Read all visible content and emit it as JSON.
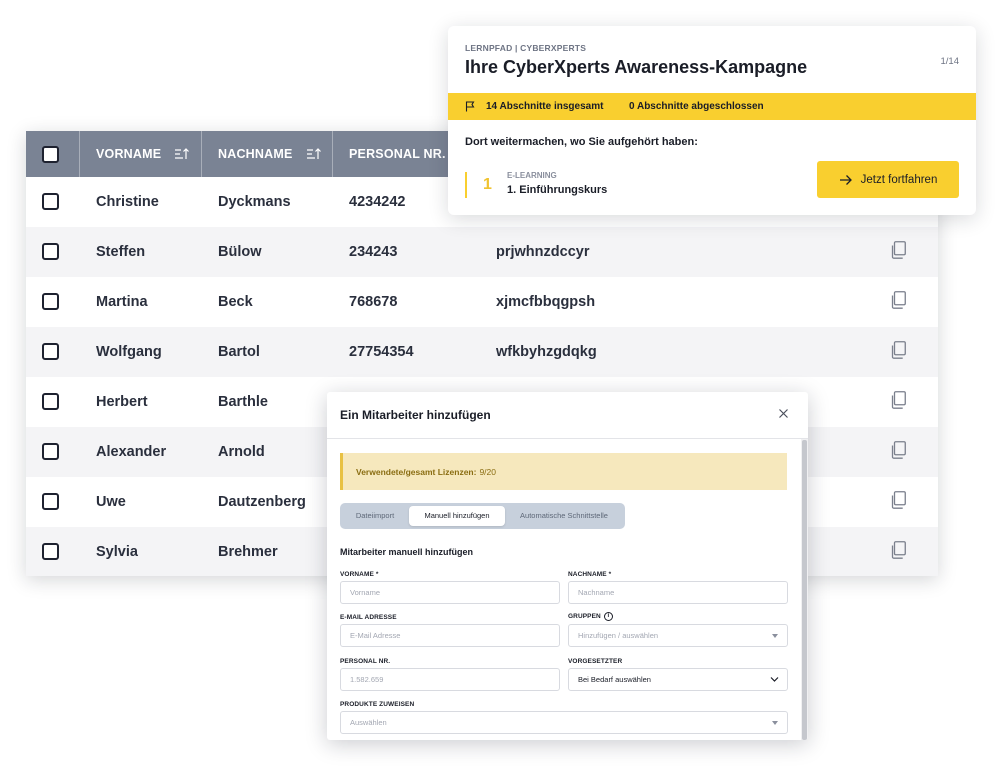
{
  "table": {
    "headers": {
      "vorname": "VORNAME",
      "nachname": "NACHNAME",
      "personal_nr": "PERSONAL NR."
    },
    "rows": [
      {
        "vorname": "Christine",
        "nachname": "Dyckmans",
        "personal_nr": "4234242",
        "code": ""
      },
      {
        "vorname": "Steffen",
        "nachname": "Bülow",
        "personal_nr": "234243",
        "code": "prjwhnzdccyr"
      },
      {
        "vorname": "Martina",
        "nachname": "Beck",
        "personal_nr": "768678",
        "code": "xjmcfbbqgpsh"
      },
      {
        "vorname": "Wolfgang",
        "nachname": "Bartol",
        "personal_nr": "27754354",
        "code": "wfkbyhzgdqkg"
      },
      {
        "vorname": "Herbert",
        "nachname": "Barthle",
        "personal_nr": "",
        "code": ""
      },
      {
        "vorname": "Alexander",
        "nachname": "Arnold",
        "personal_nr": "",
        "code": ""
      },
      {
        "vorname": "Uwe",
        "nachname": "Dautzenberg",
        "personal_nr": "",
        "code": ""
      },
      {
        "vorname": "Sylvia",
        "nachname": "Brehmer",
        "personal_nr": "",
        "code": ""
      }
    ]
  },
  "learning_path": {
    "eyebrow": "LERNPFAD | CYBERXPERTS",
    "title": "Ihre CyberXperts Awareness-Kampagne",
    "count": "1/14",
    "total": "14 Abschnitte insgesamt",
    "done": "0 Abschnitte abgeschlossen",
    "resume": "Dort weitermachen, wo Sie aufgehört haben:",
    "step_number": "1",
    "step_type": "E-LEARNING",
    "step_title": "1. Einführungskurs",
    "continue_button": "Jetzt fortfahren"
  },
  "modal": {
    "title": "Ein Mitarbeiter hinzufügen",
    "license_label": "Verwendete/gesamt Lizenzen:",
    "license_value": "9/20",
    "tabs": [
      "Dateiimport",
      "Manuell hinzufügen",
      "Automatische Schnittstelle"
    ],
    "active_tab": "Manuell hinzufügen",
    "section_title": "Mitarbeiter manuell hinzufügen",
    "fields": {
      "vorname_label": "VORNAME *",
      "vorname_placeholder": "Vorname",
      "nachname_label": "NACHNAME *",
      "nachname_placeholder": "Nachname",
      "email_label": "E-MAIL ADRESSE",
      "email_placeholder": "E-Mail Adresse",
      "gruppen_label": "GRUPPEN",
      "gruppen_placeholder": "Hinzufügen / auswählen",
      "personal_label": "PERSONAL NR.",
      "personal_value": "1.582.659",
      "vorgesetzter_label": "VORGESETZTER",
      "vorgesetzter_value": "Bei Bedarf auswählen",
      "produkte_label": "PRODUKTE ZUWEISEN",
      "produkte_placeholder": "Auswählen"
    }
  },
  "colors": {
    "accent_yellow": "#f9cf2f",
    "table_header": "#7a8394",
    "license_bg": "#f6e8bd"
  }
}
